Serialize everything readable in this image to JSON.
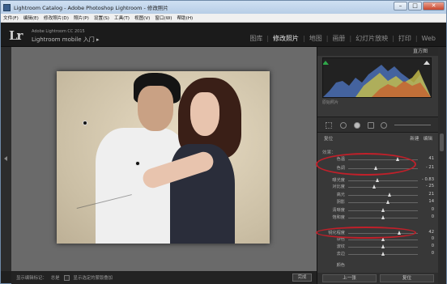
{
  "window": {
    "title": "Lightroom Catalog - Adobe Photoshop Lightroom - 修改照片",
    "min": "–",
    "max": "□",
    "close": "✕"
  },
  "menu": [
    "文件(F)",
    "编辑(E)",
    "修改照片(D)",
    "照片(P)",
    "设置(S)",
    "工具(T)",
    "视图(V)",
    "窗口(W)",
    "帮助(H)"
  ],
  "header": {
    "logo": "Lr",
    "product": "Adobe Lightroom CC 2015",
    "mobile": "Lightroom mobile 入门  ▸",
    "modules": [
      "图库",
      "修改照片",
      "地图",
      "画册",
      "幻灯片放映",
      "打印",
      "Web"
    ],
    "active_module": "修改照片"
  },
  "bottombar": {
    "label": "显示编辑标记：",
    "mode": "总是",
    "checkbox_label": "显示选定的蒙版叠加",
    "done": "完成"
  },
  "right_panel": {
    "histogram_title": "直方图",
    "histogram_info": "原始照片",
    "reset_label": "复位",
    "new_label": "新建",
    "edit_label": "编辑",
    "basic_label": "效果：",
    "sliders": [
      {
        "label": "色温",
        "value": "41",
        "pos": 0.72
      },
      {
        "label": "色调",
        "value": "- 21",
        "pos": 0.4
      },
      {
        "label": "曝光度",
        "value": "- 0.83",
        "pos": 0.42
      },
      {
        "label": "对比度",
        "value": "- 25",
        "pos": 0.38
      },
      {
        "label": "高光",
        "value": "21",
        "pos": 0.6
      },
      {
        "label": "阴影",
        "value": "14",
        "pos": 0.57
      },
      {
        "label": "清晰度",
        "value": "0",
        "pos": 0.5
      },
      {
        "label": "饱和度",
        "value": "0",
        "pos": 0.5
      },
      {
        "label": "锐化程度",
        "value": "42",
        "pos": 0.74
      },
      {
        "label": "杂色",
        "value": "0",
        "pos": 0.5
      },
      {
        "label": "波纹",
        "value": "0",
        "pos": 0.5
      },
      {
        "label": "去边",
        "value": "0",
        "pos": 0.5
      }
    ],
    "color_label": "颜色",
    "prev_button": "上一张",
    "reset_button": "复位"
  },
  "colors": {
    "annotation": "#c0202a"
  }
}
